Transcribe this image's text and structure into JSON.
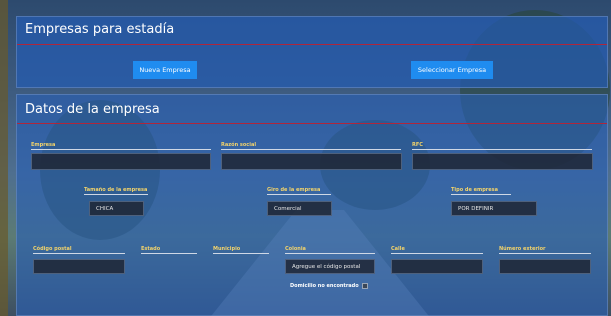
{
  "section_top": {
    "title": "Empresas para estadía",
    "buttons": {
      "nueva": "Nueva Empresa",
      "seleccionar": "Seleccionar Empresa"
    }
  },
  "section_main": {
    "title": "Datos de la empresa",
    "row1": {
      "empresa": {
        "label": "Empresa",
        "value": ""
      },
      "razon_social": {
        "label": "Razón social",
        "value": ""
      },
      "rfc": {
        "label": "RFC",
        "value": ""
      }
    },
    "row2": {
      "tamano": {
        "label": "Tamaño de la empresa",
        "value": "CHICA"
      },
      "giro": {
        "label": "Giro de la empresa",
        "value": "Comercial"
      },
      "tipo": {
        "label": "Tipo de empresa",
        "value": "POR DEFINIR"
      }
    },
    "row3": {
      "codigo_postal": {
        "label": "Código postal",
        "value": ""
      },
      "estado": {
        "label": "Estado"
      },
      "municipio": {
        "label": "Municipio"
      },
      "colonia": {
        "label": "Colonia",
        "value": "Agregue el código postal"
      },
      "calle": {
        "label": "Calle",
        "value": ""
      },
      "numero_exterior": {
        "label": "Número exterior",
        "value": ""
      }
    },
    "domicilio_msg": "Domicilio no encontrado"
  },
  "colors": {
    "accent_button": "#1f8cf0",
    "label_color": "#f2d36b",
    "rule_color": "#b0263b"
  }
}
